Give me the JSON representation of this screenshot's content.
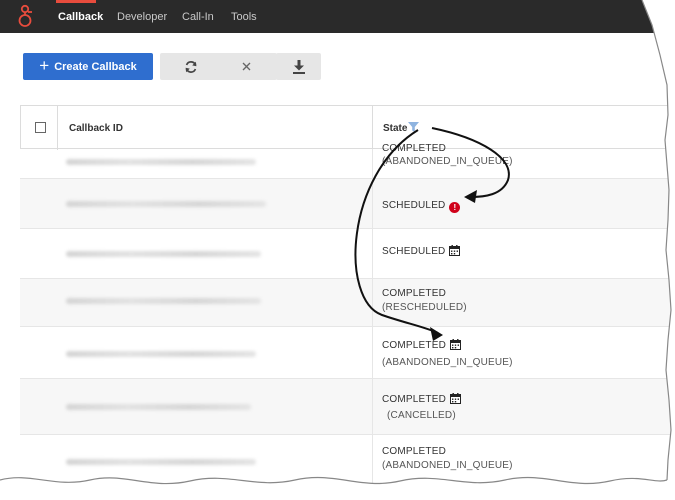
{
  "nav": {
    "items": [
      {
        "label": "Callback",
        "active": true
      },
      {
        "label": "Developer",
        "active": false
      },
      {
        "label": "Call-In",
        "active": false
      },
      {
        "label": "Tools",
        "active": false
      }
    ]
  },
  "toolbar": {
    "create_label": "Create Callback",
    "refresh_icon": "refresh-icon",
    "cancel_icon": "close-icon",
    "download_icon": "download-icon"
  },
  "table": {
    "headers": {
      "callback_id": "Callback ID",
      "state": "State"
    },
    "rows": [
      {
        "state": "COMPLETED",
        "sub": "(ABANDONED_IN_QUEUE)",
        "icon": ""
      },
      {
        "state": "SCHEDULED",
        "sub": "",
        "icon": "alert-icon"
      },
      {
        "state": "SCHEDULED",
        "sub": "",
        "icon": "calendar-icon"
      },
      {
        "state": "COMPLETED",
        "sub": "(RESCHEDULED)",
        "icon": ""
      },
      {
        "state": "COMPLETED",
        "sub": "(ABANDONED_IN_QUEUE)",
        "icon": "calendar-icon"
      },
      {
        "state": "COMPLETED",
        "sub": "(CANCELLED)",
        "icon": "calendar-icon"
      },
      {
        "state": "COMPLETED",
        "sub": "(ABANDONED_IN_QUEUE)",
        "icon": ""
      }
    ]
  },
  "colors": {
    "topbar": "#2a2a2a",
    "accent_red": "#e84c3d",
    "primary_button": "#2f6ecf",
    "alert": "#d0021b"
  }
}
